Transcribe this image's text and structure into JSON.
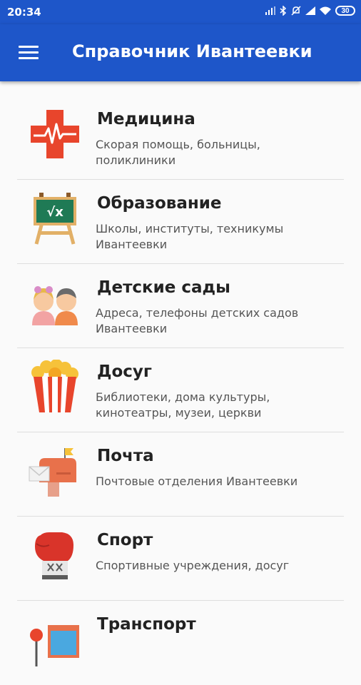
{
  "status_bar": {
    "time": "20:34",
    "battery": "30",
    "icons": [
      "signal-icon",
      "bluetooth-icon",
      "mute-icon",
      "wifi-icon",
      "battery-icon"
    ]
  },
  "app_bar": {
    "title": "Справочник Ивантеевки"
  },
  "colors": {
    "primary": "#1e56c9",
    "background": "#fafafa"
  },
  "categories": [
    {
      "title": "Медицина",
      "desc": "Скорая помощь, больницы, поликлиники",
      "icon": "medicine-cross-icon"
    },
    {
      "title": "Образование",
      "desc": "Школы, институты, техникумы Ивантеевки",
      "icon": "chalkboard-icon"
    },
    {
      "title": "Детские сады",
      "desc": "Адреса, телефоны детских садов Ивантеевки",
      "icon": "children-icon"
    },
    {
      "title": "Досуг",
      "desc": "Библиотеки, дома культуры, кинотеатры, музеи, церкви",
      "icon": "popcorn-icon"
    },
    {
      "title": "Почта",
      "desc": "Почтовые отделения Ивантеевки",
      "icon": "mailbox-icon"
    },
    {
      "title": "Спорт",
      "desc": "Спортивные учреждения, досуг",
      "icon": "boxing-glove-icon"
    },
    {
      "title": "Транспорт",
      "desc": "",
      "icon": "bus-stop-icon"
    }
  ]
}
